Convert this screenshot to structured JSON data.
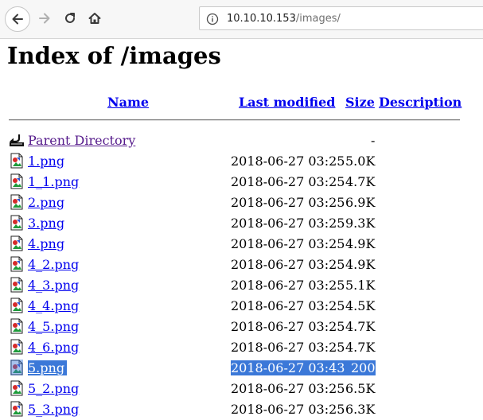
{
  "browser": {
    "url_host": "10.10.10.153",
    "url_path": "/images/"
  },
  "page": {
    "title": "Index of /images"
  },
  "columns": {
    "name": "Name",
    "last_modified": "Last modified",
    "size": "Size",
    "description": "Description"
  },
  "parent": {
    "label": "Parent Directory",
    "size": "-"
  },
  "files": [
    {
      "name": "1.png",
      "modified": "2018-06-27 03:25",
      "size": "5.0K"
    },
    {
      "name": "1_1.png",
      "modified": "2018-06-27 03:25",
      "size": "4.7K"
    },
    {
      "name": "2.png",
      "modified": "2018-06-27 03:25",
      "size": "6.9K"
    },
    {
      "name": "3.png",
      "modified": "2018-06-27 03:25",
      "size": "9.3K"
    },
    {
      "name": "4.png",
      "modified": "2018-06-27 03:25",
      "size": "4.9K"
    },
    {
      "name": "4_2.png",
      "modified": "2018-06-27 03:25",
      "size": "4.9K"
    },
    {
      "name": "4_3.png",
      "modified": "2018-06-27 03:25",
      "size": "5.1K"
    },
    {
      "name": "4_4.png",
      "modified": "2018-06-27 03:25",
      "size": "4.5K"
    },
    {
      "name": "4_5.png",
      "modified": "2018-06-27 03:25",
      "size": "4.7K"
    },
    {
      "name": "4_6.png",
      "modified": "2018-06-27 03:25",
      "size": "4.7K"
    },
    {
      "name": "5.png",
      "modified": "2018-06-27 03:43",
      "size": "200",
      "selected": true
    },
    {
      "name": "5_2.png",
      "modified": "2018-06-27 03:25",
      "size": "6.5K"
    },
    {
      "name": "5_3.png",
      "modified": "2018-06-27 03:25",
      "size": "6.3K"
    }
  ],
  "colors": {
    "link": "#0000ee",
    "visited_link": "#551a8b",
    "selection": "#3b78d8"
  }
}
